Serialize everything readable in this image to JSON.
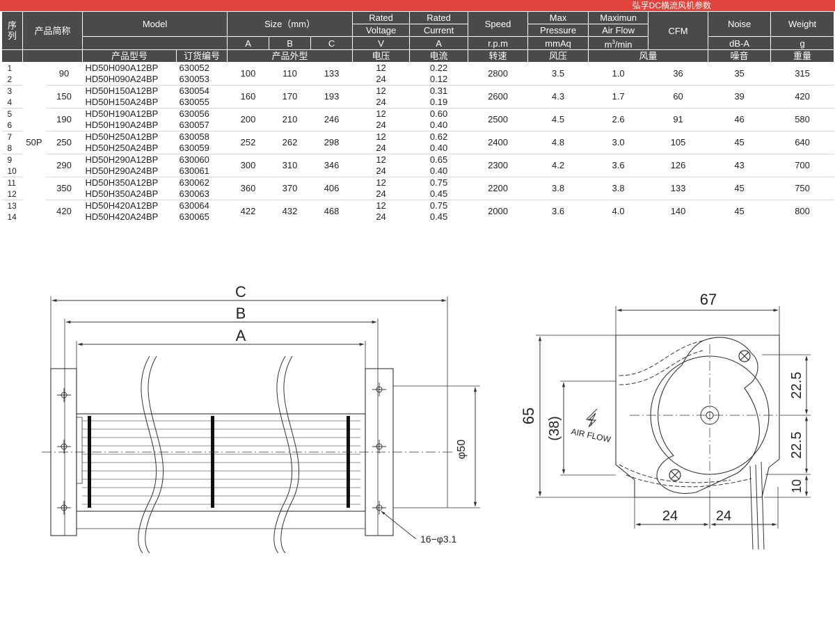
{
  "banner_title": "弘孚DC横流风机参数",
  "header": {
    "seq": "序\n列",
    "seq_top": "序",
    "seq_bottom": "列",
    "short_name": "产品简称",
    "model": "Model",
    "size": "Size（mm）",
    "size_a": "A",
    "size_b": "B",
    "size_c": "C",
    "rated_voltage_1": "Rated",
    "rated_voltage_2": "Voltage",
    "rated_current_1": "Rated",
    "rated_current_2": "Current",
    "speed": "Speed",
    "max_pressure_1": "Max",
    "max_pressure_2": "Pressure",
    "max_airflow_1": "Maximun",
    "max_airflow_2": "Air Flow",
    "cfm": "CFM",
    "noise": "Noise",
    "weight": "Weight",
    "unit_v": "V",
    "unit_a": "A",
    "unit_rpm": "r.p.m",
    "unit_mmaq": "mmAq",
    "unit_m3min_a": "m",
    "unit_m3min_sup": "3",
    "unit_m3min_b": "/min",
    "unit_dba": "dB-A",
    "unit_g": "g",
    "cn_model": "产品型号",
    "cn_order": "订货编号",
    "cn_size": "产品外型",
    "cn_voltage": "电压",
    "cn_current": "电流",
    "cn_speed": "转速",
    "cn_pressure": "风压",
    "cn_airflow": "风量",
    "cn_noise": "噪音",
    "cn_weight": "重量"
  },
  "series_label": "50P",
  "groups": [
    {
      "size": "90",
      "A": "100",
      "B": "110",
      "C": "133",
      "speed": "2800",
      "pressure": "3.5",
      "airflow": "1.0",
      "cfm": "36",
      "noise": "35",
      "weight": "315",
      "rows": [
        {
          "seq": "1",
          "model": "HD50H090A12BP",
          "order": "630052",
          "voltage": "12",
          "current": "0.22"
        },
        {
          "seq": "2",
          "model": "HD50H090A24BP",
          "order": "630053",
          "voltage": "24",
          "current": "0.12"
        }
      ]
    },
    {
      "size": "150",
      "A": "160",
      "B": "170",
      "C": "193",
      "speed": "2600",
      "pressure": "4.3",
      "airflow": "1.7",
      "cfm": "60",
      "noise": "39",
      "weight": "420",
      "rows": [
        {
          "seq": "3",
          "model": "HD50H150A12BP",
          "order": "630054",
          "voltage": "12",
          "current": "0.31"
        },
        {
          "seq": "4",
          "model": "HD50H150A24BP",
          "order": "630055",
          "voltage": "24",
          "current": "0.19"
        }
      ]
    },
    {
      "size": "190",
      "A": "200",
      "B": "210",
      "C": "246",
      "speed": "2500",
      "pressure": "4.5",
      "airflow": "2.6",
      "cfm": "91",
      "noise": "46",
      "weight": "580",
      "rows": [
        {
          "seq": "5",
          "model": "HD50H190A12BP",
          "order": "630056",
          "voltage": "12",
          "current": "0.60"
        },
        {
          "seq": "6",
          "model": "HD50H190A24BP",
          "order": "630057",
          "voltage": "24",
          "current": "0.40"
        }
      ]
    },
    {
      "size": "250",
      "A": "252",
      "B": "262",
      "C": "298",
      "speed": "2400",
      "pressure": "4.8",
      "airflow": "3.0",
      "cfm": "105",
      "noise": "45",
      "weight": "640",
      "rows": [
        {
          "seq": "7",
          "model": "HD50H250A12BP",
          "order": "630058",
          "voltage": "12",
          "current": "0.62"
        },
        {
          "seq": "8",
          "model": "HD50H250A24BP",
          "order": "630059",
          "voltage": "24",
          "current": "0.40"
        }
      ]
    },
    {
      "size": "290",
      "A": "300",
      "B": "310",
      "C": "346",
      "speed": "2300",
      "pressure": "4.2",
      "airflow": "3.6",
      "cfm": "126",
      "noise": "43",
      "weight": "700",
      "rows": [
        {
          "seq": "9",
          "model": "HD50H290A12BP",
          "order": "630060",
          "voltage": "12",
          "current": "0.65"
        },
        {
          "seq": "10",
          "model": "HD50H290A24BP",
          "order": "630061",
          "voltage": "24",
          "current": "0.40"
        }
      ]
    },
    {
      "size": "350",
      "A": "360",
      "B": "370",
      "C": "406",
      "speed": "2200",
      "pressure": "3.8",
      "airflow": "3.8",
      "cfm": "133",
      "noise": "45",
      "weight": "750",
      "rows": [
        {
          "seq": "11",
          "model": "HD50H350A12BP",
          "order": "630062",
          "voltage": "12",
          "current": "0.75"
        },
        {
          "seq": "12",
          "model": "HD50H350A24BP",
          "order": "630063",
          "voltage": "24",
          "current": "0.45"
        }
      ]
    },
    {
      "size": "420",
      "A": "422",
      "B": "432",
      "C": "468",
      "speed": "2000",
      "pressure": "3.6",
      "airflow": "4.0",
      "cfm": "140",
      "noise": "45",
      "weight": "800",
      "rows": [
        {
          "seq": "13",
          "model": "HD50H420A12BP",
          "order": "630064",
          "voltage": "12",
          "current": "0.75"
        },
        {
          "seq": "14",
          "model": "HD50H420A24BP",
          "order": "630065",
          "voltage": "24",
          "current": "0.45"
        }
      ]
    }
  ],
  "drawing": {
    "front": {
      "dim_c": "C",
      "dim_b": "B",
      "dim_a": "A",
      "dim_dia": "φ50",
      "holes_note": "16−φ3.1"
    },
    "side": {
      "dim_width": "67",
      "dim_height": "65",
      "dim_inner": "(38)",
      "dim_upper": "22.5",
      "dim_lower": "22.5",
      "dim_bottom": "10",
      "dim_left": "24",
      "dim_right": "24",
      "airflow_label": "AIR FLOW"
    }
  }
}
